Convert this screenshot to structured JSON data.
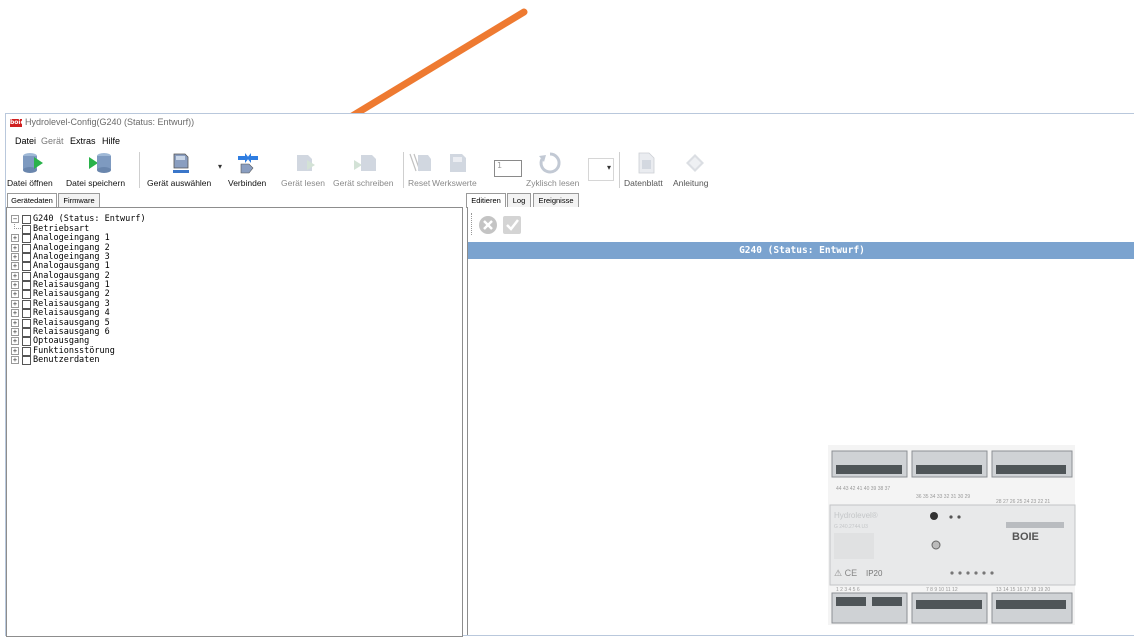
{
  "window": {
    "title": "Hydrolevel-Config(G240 (Status: Entwurf))",
    "icon_label": "boie"
  },
  "menu": [
    "Datei",
    "Gerät",
    "Extras",
    "Hilfe"
  ],
  "toolbar": {
    "open_file": "Datei öffnen",
    "save_file": "Datei speichern",
    "select_device": "Gerät auswählen",
    "connect": "Verbinden",
    "read_device": "Gerät lesen",
    "write_device": "Gerät schreiben",
    "reset": "Reset",
    "factory_values": "Werkswerte",
    "cycle_value": "1",
    "cyclic_read": "Zyklisch lesen",
    "datasheet": "Datenblatt",
    "manual": "Anleitung"
  },
  "left_tabs": [
    "Gerätedaten",
    "Firmware"
  ],
  "right_tabs": [
    "Editieren",
    "Log",
    "Ereignisse"
  ],
  "tree": {
    "root": "G240 (Status: Entwurf)",
    "items": [
      "Betriebsart",
      "Analogeingang 1",
      "Analogeingang 2",
      "Analogeingang 3",
      "Analogausgang 1",
      "Analogausgang 2",
      "Relaisausgang 1",
      "Relaisausgang 2",
      "Relaisausgang 3",
      "Relaisausgang 4",
      "Relaisausgang 5",
      "Relaisausgang 6",
      "Optoausgang",
      "Funktionsstörung",
      "Benutzerdaten"
    ]
  },
  "editor": {
    "header": "G240 (Status: Entwurf)"
  },
  "device": {
    "brand_line": "Hydrolevel®",
    "model": "G 240.2744.U3",
    "ip_rating": "IP20",
    "manufacturer": "BOIE",
    "terminals_top_left": "44 43 42 41 40 39 38 37",
    "terminals_top_mid": "36 35 34 33 32 31 30 29",
    "terminals_top_right": "28 27 26 25 24 23 22 21",
    "terminals_bot_left": "1 2 3 4 5 6",
    "terminals_bot_mid": "7 8 9 10 11 12",
    "terminals_bot_right": "13 14 15 16 17 18 19 20"
  },
  "colors": {
    "arrow": "#ee7a31",
    "header": "#7ba3cf",
    "connect_icon": "#2f7de1"
  }
}
